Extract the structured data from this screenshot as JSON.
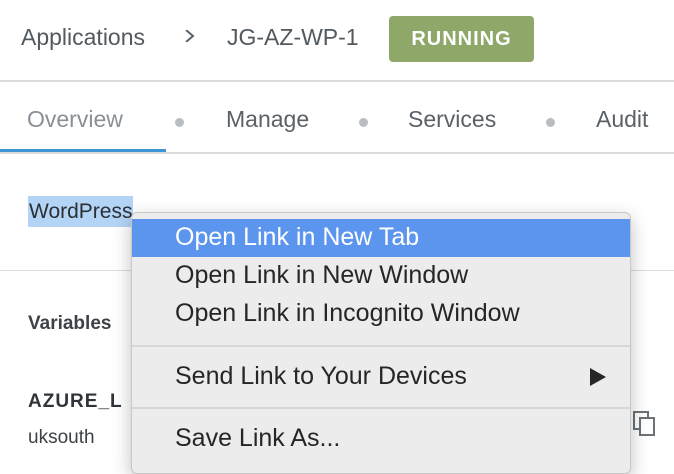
{
  "breadcrumb": {
    "applications": "Applications",
    "app_name": "JG-AZ-WP-1"
  },
  "status_badge": "RUNNING",
  "tabs": [
    "Overview",
    "Manage",
    "Services",
    "Audit"
  ],
  "content": {
    "link_text": "WordPress",
    "section_title": "Variables",
    "variable_name": "AZURE_L",
    "variable_value": "uksouth"
  },
  "context_menu": {
    "items": [
      "Open Link in New Tab",
      "Open Link in New Window",
      "Open Link in Incognito Window",
      "Send Link to Your Devices",
      "Save Link As..."
    ]
  },
  "colors": {
    "badge": "#8fa86a",
    "tab_underline": "#3e96d6",
    "menu_highlight": "#5b95ee",
    "selection": "#b3d4f5"
  }
}
